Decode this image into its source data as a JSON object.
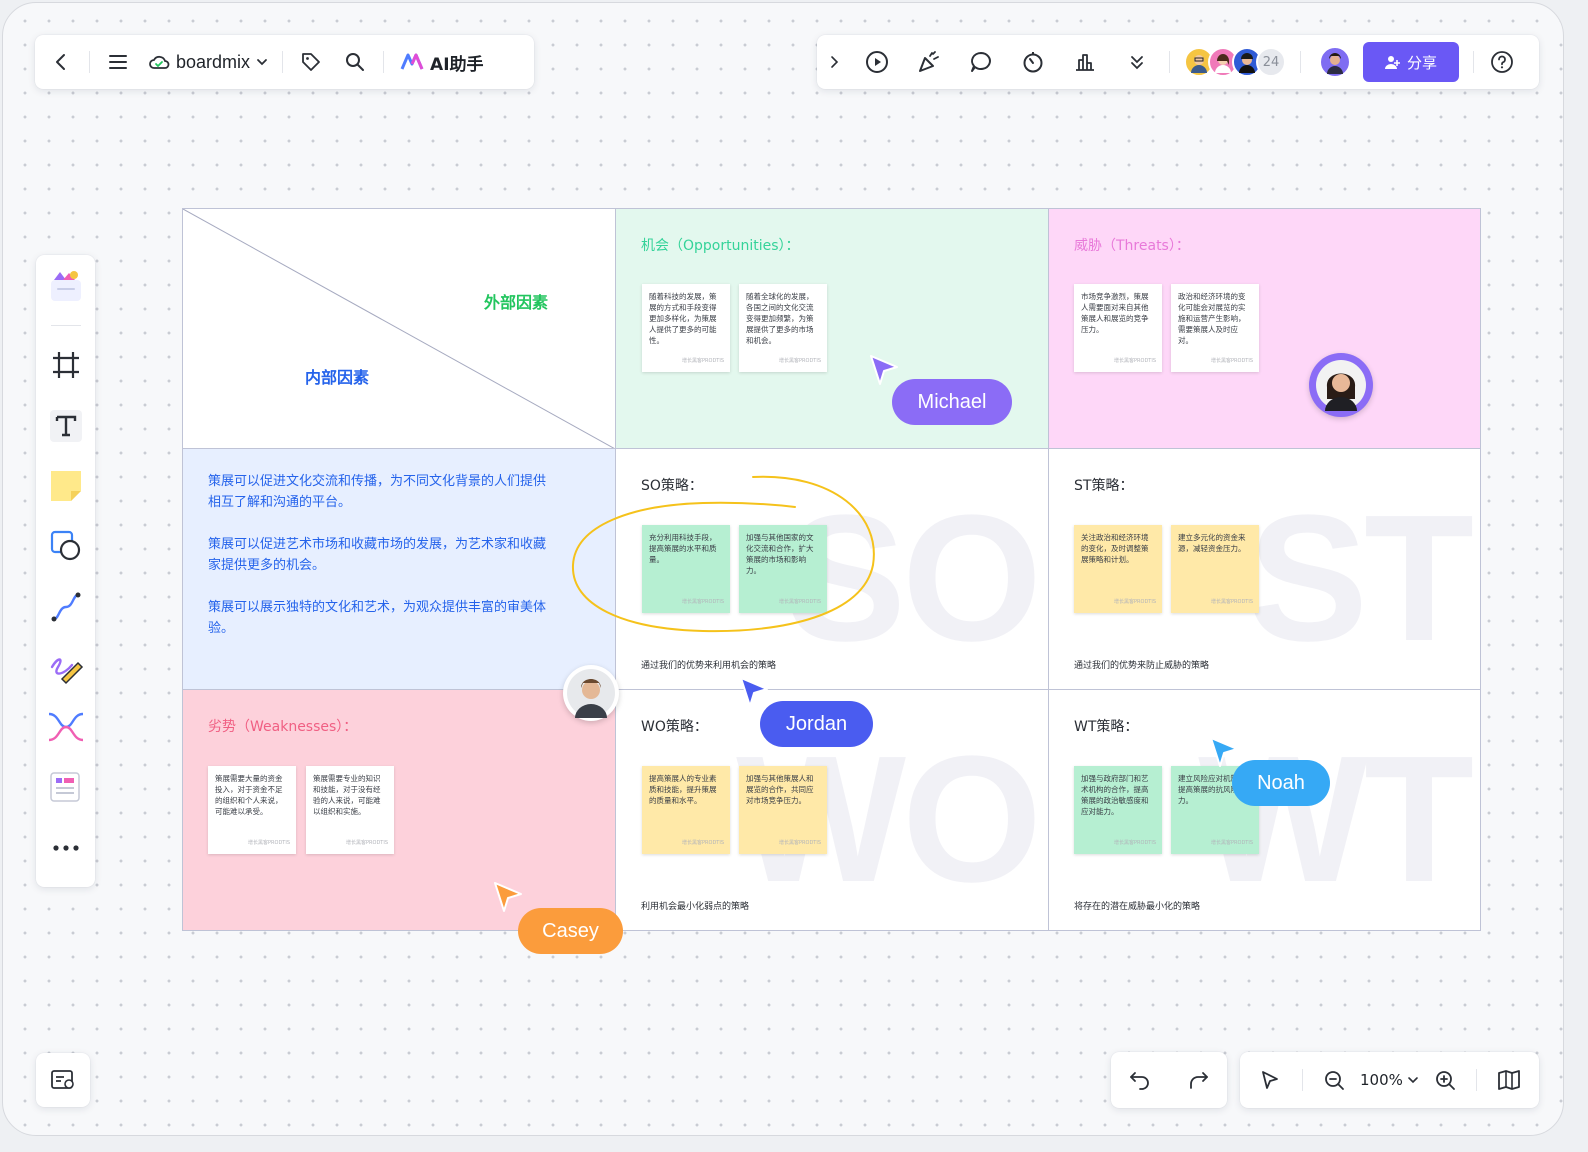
{
  "toolbar": {
    "brand": "boardmix",
    "ai_label": "AI助手",
    "collaborator_count": "24",
    "share_label": "分享"
  },
  "zoom": {
    "level": "100%"
  },
  "matrix": {
    "external_label": "外部因素",
    "internal_label": "内部因素",
    "opportunities": {
      "title": "机会（Opportunities）：",
      "notes": [
        "随着科技的发展，策展的方式和手段变得更加多样化，为策展人提供了更多的可能性。",
        "随着全球化的发展，各国之间的文化交流变得更加频繁，为策展提供了更多的市场和机会。"
      ]
    },
    "threats": {
      "title": "威胁（Threats）：",
      "notes": [
        "市场竞争激烈，策展人需要面对来自其他策展人和展览的竞争压力。",
        "政治和经济环境的变化可能会对展览的实施和运营产生影响，需要策展人及时应对。"
      ]
    },
    "strengths": {
      "paragraphs": [
        "策展可以促进文化交流和传播，为不同文化背景的人们提供相互了解和沟通的平台。",
        "策展可以促进艺术市场和收藏市场的发展，为艺术家和收藏家提供更多的机会。",
        "策展可以展示独特的文化和艺术，为观众提供丰富的审美体验。"
      ]
    },
    "weaknesses": {
      "title": "劣势（Weaknesses）：",
      "notes": [
        "策展需要大量的资金投入，对于资金不足的组织和个人来说，可能难以承受。",
        "策展需要专业的知识和技能，对于没有经验的人来说，可能难以组织和实施。"
      ]
    },
    "so": {
      "title": "SO策略：",
      "watermark": "SO",
      "footer": "通过我们的优势来利用机会的策略",
      "notes": [
        "充分利用科技手段，提高策展的水平和质量。",
        "加强与其他国家的文化交流和合作，扩大策展的市场和影响力。"
      ]
    },
    "st": {
      "title": "ST策略：",
      "watermark": "ST",
      "footer": "通过我们的优势来防止威胁的策略",
      "notes": [
        "关注政治和经济环境的变化，及时调整策展策略和计划。",
        "建立多元化的资金来源，减轻资金压力。"
      ]
    },
    "wo": {
      "title": "WO策略：",
      "watermark": "WO",
      "footer": "利用机会最小化弱点的策略",
      "notes": [
        "提高策展人的专业素质和技能，提升策展的质量和水平。",
        "加强与其他策展人和展览的合作，共同应对市场竞争压力。"
      ]
    },
    "wt": {
      "title": "WT策略：",
      "watermark": "WT",
      "footer": "将存在的潜在威胁最小化的策略",
      "notes": [
        "加强与政府部门和艺术机构的合作，提高策展的政治敏感度和应对能力。",
        "建立风险应对机制，提高策展的抗风险能力。"
      ]
    },
    "note_footer": "增长黑客PRODTIS"
  },
  "cursors": {
    "michael": "Michael",
    "jordan": "Jordan",
    "noah": "Noah",
    "casey": "Casey"
  },
  "colors": {
    "accent": "#6a58f5",
    "michael": "#8b6cf6",
    "jordan": "#4a5cf0",
    "noah": "#36a9f5",
    "casey": "#fb9c3c",
    "opportunities_bg": "#e3f8ee",
    "threats_bg": "#fed7f8",
    "strengths_bg": "#e7efff",
    "weaknesses_bg": "#fdd1db"
  },
  "icons": {
    "toolbar_left": [
      "back-icon",
      "menu-icon",
      "cloud-icon",
      "chevron-down-icon",
      "tag-icon",
      "search-icon",
      "ai-logo-icon"
    ],
    "toolbar_right": [
      "chevron-right-icon",
      "play-icon",
      "celebrate-icon",
      "comment-icon",
      "timer-icon",
      "vote-icon",
      "more-down-icon",
      "help-icon"
    ],
    "left_tools": [
      "template-icon",
      "frame-icon",
      "text-icon",
      "sticky-note-icon",
      "shape-icon",
      "connector-icon",
      "pen-icon",
      "mindmap-icon",
      "table-icon",
      "more-icon"
    ],
    "bottom": [
      "minimap-icon",
      "undo-icon",
      "redo-icon",
      "select-icon",
      "zoom-out-icon",
      "zoom-in-icon",
      "book-icon"
    ]
  }
}
